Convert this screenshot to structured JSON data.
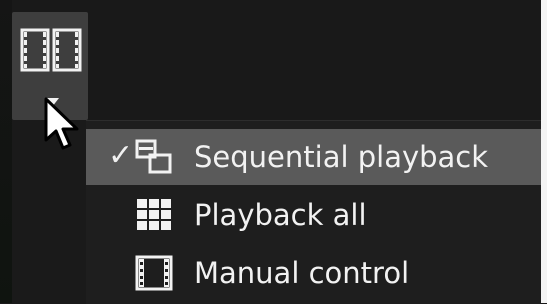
{
  "toolbar": {
    "mode_button_icon": "film-frames-icon",
    "dropdown_icon": "chevron-down-icon"
  },
  "menu": {
    "items": [
      {
        "label": "Sequential playback",
        "icon": "sequential-frames-icon",
        "selected": true
      },
      {
        "label": "Playback all",
        "icon": "grid-icon",
        "selected": false
      },
      {
        "label": "Manual control",
        "icon": "film-frame-icon",
        "selected": false
      }
    ],
    "check_glyph": "✓"
  },
  "colors": {
    "background": "#1a1a1a",
    "button": "#3e3e3e",
    "selected_row": "#5a5a5a",
    "text": "#f2f2f2"
  }
}
